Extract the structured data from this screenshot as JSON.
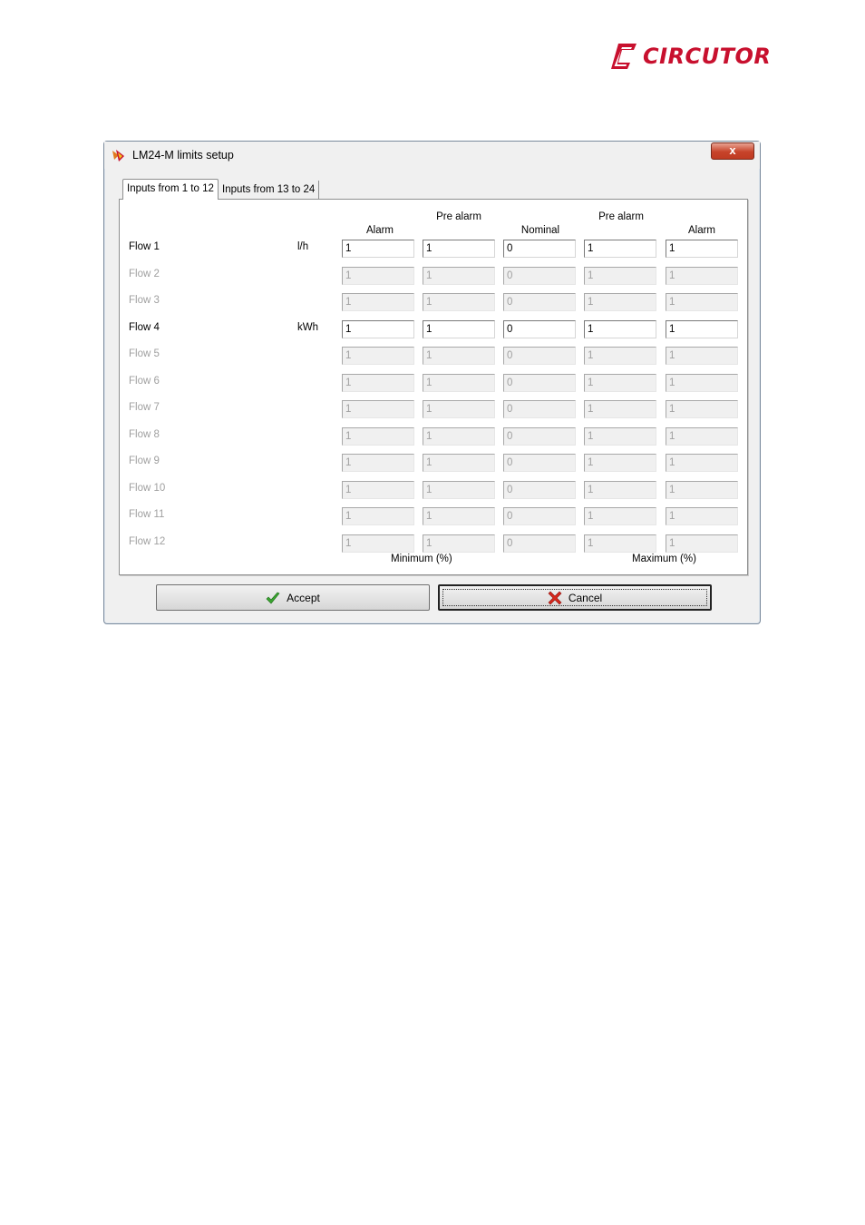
{
  "brand": {
    "logo_text": "CIRCUTOR",
    "color": "#c8102e"
  },
  "window": {
    "title": "LM24-M limits setup",
    "close_symbol": "x"
  },
  "tabs": [
    {
      "label": "Inputs from 1 to 12",
      "active": true
    },
    {
      "label": "Inputs from 13 to 24",
      "active": false
    }
  ],
  "headers": {
    "alarm_min": "Alarm",
    "prealarm_min": "Pre alarm",
    "nominal": "Nominal",
    "prealarm_max": "Pre alarm",
    "alarm_max": "Alarm"
  },
  "rows": [
    {
      "name": "Flow 1",
      "unit": "l/h",
      "enabled": true,
      "values": [
        "1",
        "1",
        "0",
        "1",
        "1"
      ]
    },
    {
      "name": "Flow 2",
      "unit": "",
      "enabled": false,
      "values": [
        "1",
        "1",
        "0",
        "1",
        "1"
      ]
    },
    {
      "name": "Flow 3",
      "unit": "",
      "enabled": false,
      "values": [
        "1",
        "1",
        "0",
        "1",
        "1"
      ]
    },
    {
      "name": "Flow 4",
      "unit": "kWh",
      "enabled": true,
      "values": [
        "1",
        "1",
        "0",
        "1",
        "1"
      ]
    },
    {
      "name": "Flow 5",
      "unit": "",
      "enabled": false,
      "values": [
        "1",
        "1",
        "0",
        "1",
        "1"
      ]
    },
    {
      "name": "Flow 6",
      "unit": "",
      "enabled": false,
      "values": [
        "1",
        "1",
        "0",
        "1",
        "1"
      ]
    },
    {
      "name": "Flow 7",
      "unit": "",
      "enabled": false,
      "values": [
        "1",
        "1",
        "0",
        "1",
        "1"
      ]
    },
    {
      "name": "Flow 8",
      "unit": "",
      "enabled": false,
      "values": [
        "1",
        "1",
        "0",
        "1",
        "1"
      ]
    },
    {
      "name": "Flow 9",
      "unit": "",
      "enabled": false,
      "values": [
        "1",
        "1",
        "0",
        "1",
        "1"
      ]
    },
    {
      "name": "Flow 10",
      "unit": "",
      "enabled": false,
      "values": [
        "1",
        "1",
        "0",
        "1",
        "1"
      ]
    },
    {
      "name": "Flow 11",
      "unit": "",
      "enabled": false,
      "values": [
        "1",
        "1",
        "0",
        "1",
        "1"
      ]
    },
    {
      "name": "Flow 12",
      "unit": "",
      "enabled": false,
      "values": [
        "1",
        "1",
        "0",
        "1",
        "1"
      ]
    }
  ],
  "footer": {
    "minimum": "Minimum (%)",
    "maximum": "Maximum (%)"
  },
  "buttons": {
    "accept": {
      "label": "Accept",
      "icon": "checkmark-icon",
      "color": "#3aa630"
    },
    "cancel": {
      "label": "Cancel",
      "icon": "cross-icon",
      "color": "#d8281c"
    }
  }
}
